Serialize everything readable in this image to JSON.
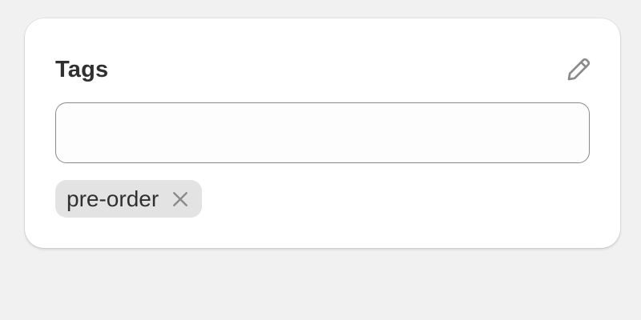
{
  "card": {
    "title": "Tags",
    "edit_icon": "pencil-icon"
  },
  "input": {
    "value": "",
    "placeholder": ""
  },
  "tags": [
    {
      "label": "pre-order",
      "remove_icon": "close-icon"
    }
  ],
  "colors": {
    "background": "#f1f1f1",
    "card": "#ffffff",
    "text": "#303030",
    "tag_background": "#e3e3e3",
    "border": "#8a8a8a",
    "icon": "#8a8a8a"
  }
}
